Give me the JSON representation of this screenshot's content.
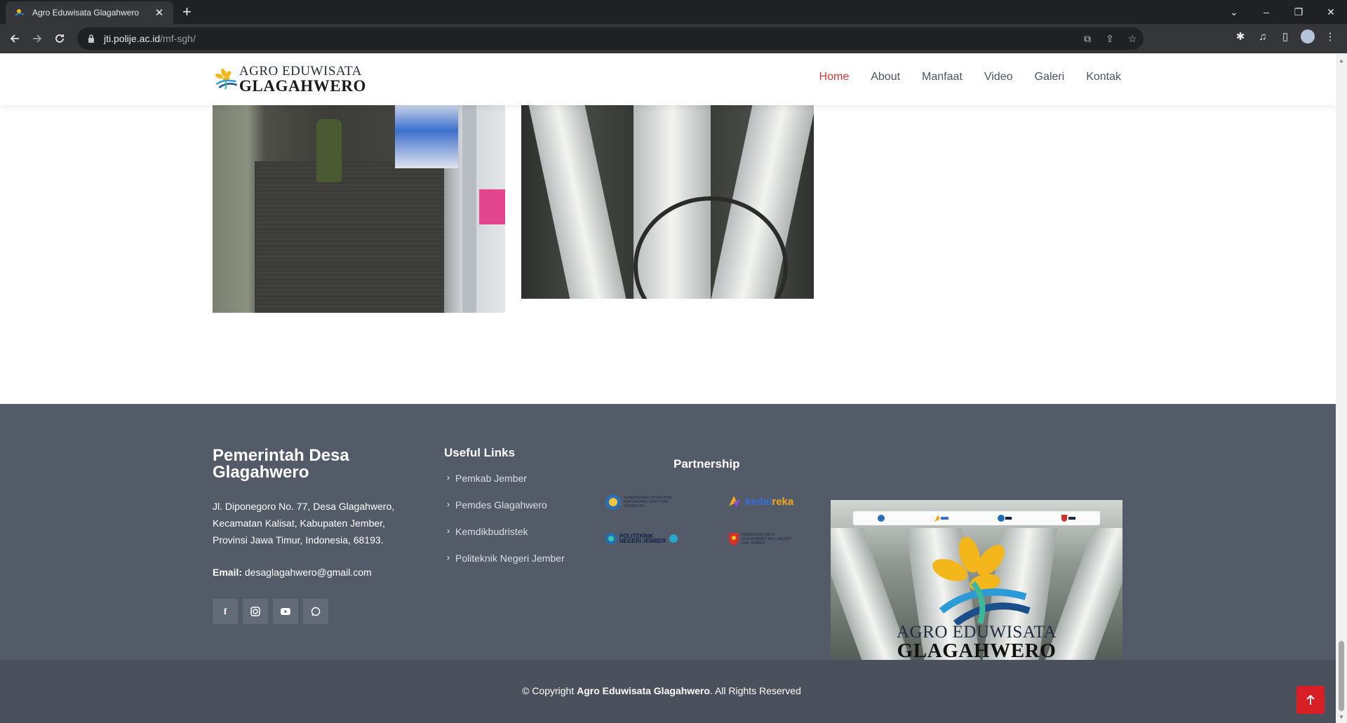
{
  "browser": {
    "tab_title": "Agro Eduwisata Glagahwero",
    "tab_close": "✕",
    "new_tab": "+",
    "url_host": "jti.polije.ac.id",
    "url_path": "/mf-sgh/",
    "window_controls": [
      "⌄",
      "–",
      "❐",
      "✕"
    ]
  },
  "header": {
    "logo_line1": "AGRO EDUWISATA",
    "logo_line2": "GLAGAHWERO",
    "nav": [
      "Home",
      "About",
      "Manfaat",
      "Video",
      "Galeri",
      "Kontak"
    ],
    "active_nav": "Home"
  },
  "footer": {
    "title": "Pemerintah Desa Glagahwero",
    "address": "Jl. Diponegoro No. 77, Desa Glagahwero, Kecamatan Kalisat, Kabupaten Jember, Provinsi Jawa Timur, Indonesia, 68193.",
    "email_label": "Email:",
    "email": "desaglagahwero@gmail.com",
    "social": [
      "facebook-icon",
      "instagram-icon",
      "youtube-icon",
      "whatsapp-icon"
    ],
    "links_title": "Useful Links",
    "links": [
      "Pemkab Jember",
      "Pemdes Glagahwero",
      "Kemdikbudristek",
      "Politeknik Negeri Jember"
    ],
    "partnership_title": "Partnership",
    "partners": {
      "kemdikbud": "KEMENTERIAN PENDIDIKAN, KEBUDAYAAN, RISET DAN TEKNOLOGI",
      "kedaireka_1": "kedai",
      "kedaireka_2": "reka",
      "polije": "POLITEKNIK NEGERI JEMBER",
      "desa": "PEMERINTAH DESA GLAGAHWERO KEC. KALISAT KAB. JEMBER"
    },
    "promo_line1": "AGRO EDUWISATA",
    "promo_line2": "GLAGAHWERO"
  },
  "copyright": {
    "prefix": "© Copyright",
    "name": "Agro Eduwisata Glagahwero",
    "suffix": ". All Rights Reserved"
  },
  "colors": {
    "accent_red": "#d63a3a",
    "footer_bg": "#535a68",
    "copyright_bg": "#4a505c",
    "back_to_top": "#d81f26"
  }
}
